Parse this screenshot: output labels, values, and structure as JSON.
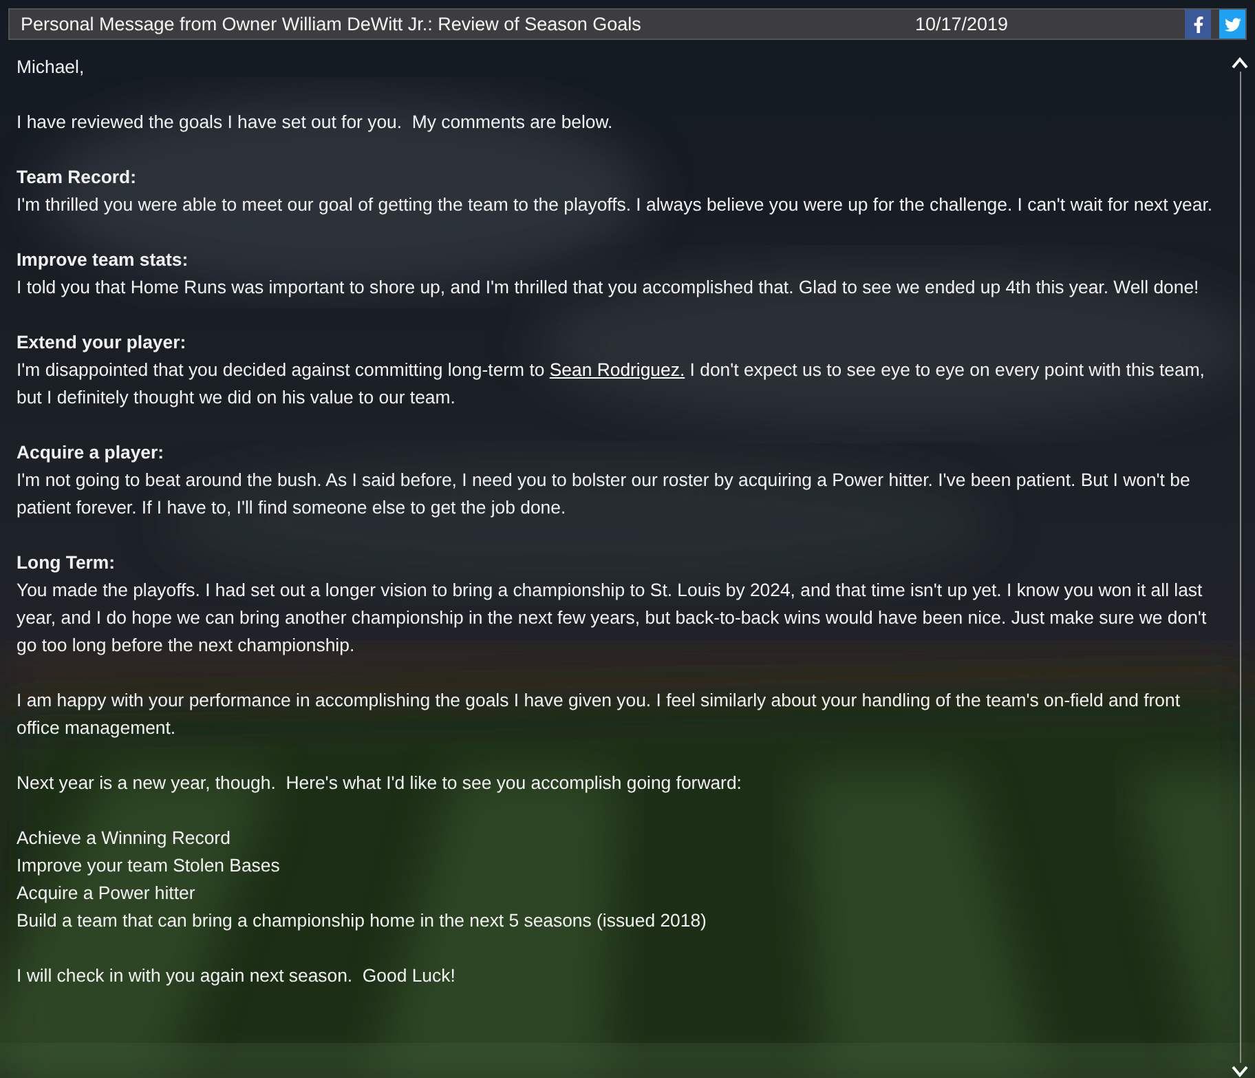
{
  "header": {
    "title": "Personal Message from Owner William DeWitt Jr.: Review of Season Goals",
    "date": "10/17/2019"
  },
  "sections": [
    {
      "paragraphs": [
        {
          "text": "Michael,"
        }
      ]
    },
    {
      "paragraphs": [
        {
          "text": "I have reviewed the goals I have set out for you.  My comments are below."
        }
      ]
    },
    {
      "heading": "Team Record:",
      "paragraphs": [
        {
          "text": "I'm thrilled you were able to meet our goal of getting the team to the playoffs. I always believe you were up for the challenge. I can't wait for next year."
        }
      ]
    },
    {
      "heading": "Improve team stats:",
      "paragraphs": [
        {
          "text": "I told you that Home Runs was important to shore up, and I'm thrilled that you accomplished that. Glad to see we ended up 4th this year. Well done!"
        }
      ]
    },
    {
      "heading": "Extend your player:",
      "paragraphs": [
        {
          "text": "I'm disappointed that you decided against committing long-term to ",
          "link": "Sean Rodriguez.",
          "after": " I don't expect us to see eye to eye on every point with this team, but I definitely thought we did on his value to our team."
        }
      ]
    },
    {
      "heading": "Acquire a player:",
      "paragraphs": [
        {
          "text": "I'm not going to beat around the bush. As I said before, I need you to bolster our roster by acquiring a Power hitter. I've been patient. But I won't be patient forever. If I have to, I'll find someone else to get the job done."
        }
      ]
    },
    {
      "heading": "Long Term:",
      "paragraphs": [
        {
          "text": "You made the playoffs. I had set out a longer vision to bring a championship to St. Louis by 2024, and that time isn't up yet. I know you won it all last year, and I do hope we can bring another championship in the next few years, but back-to-back wins would have been nice. Just make sure we don't go too long before the next championship."
        }
      ]
    },
    {
      "paragraphs": [
        {
          "text": "I am happy with your performance in accomplishing the goals I have given you. I feel similarly about your handling of the team's on-field and front office management."
        }
      ]
    },
    {
      "paragraphs": [
        {
          "text": "Next year is a new year, though.  Here's what I'd like to see you accomplish going forward:"
        }
      ]
    },
    {
      "paragraphs": [
        {
          "text": "Achieve a Winning Record"
        },
        {
          "text": "Improve your team Stolen Bases"
        },
        {
          "text": "Acquire a Power hitter"
        },
        {
          "text": "Build a team that can bring a championship home in the next 5 seasons (issued 2018)"
        }
      ]
    },
    {
      "paragraphs": [
        {
          "text": "I will check in with you again next season.  Good Luck!"
        }
      ]
    }
  ]
}
